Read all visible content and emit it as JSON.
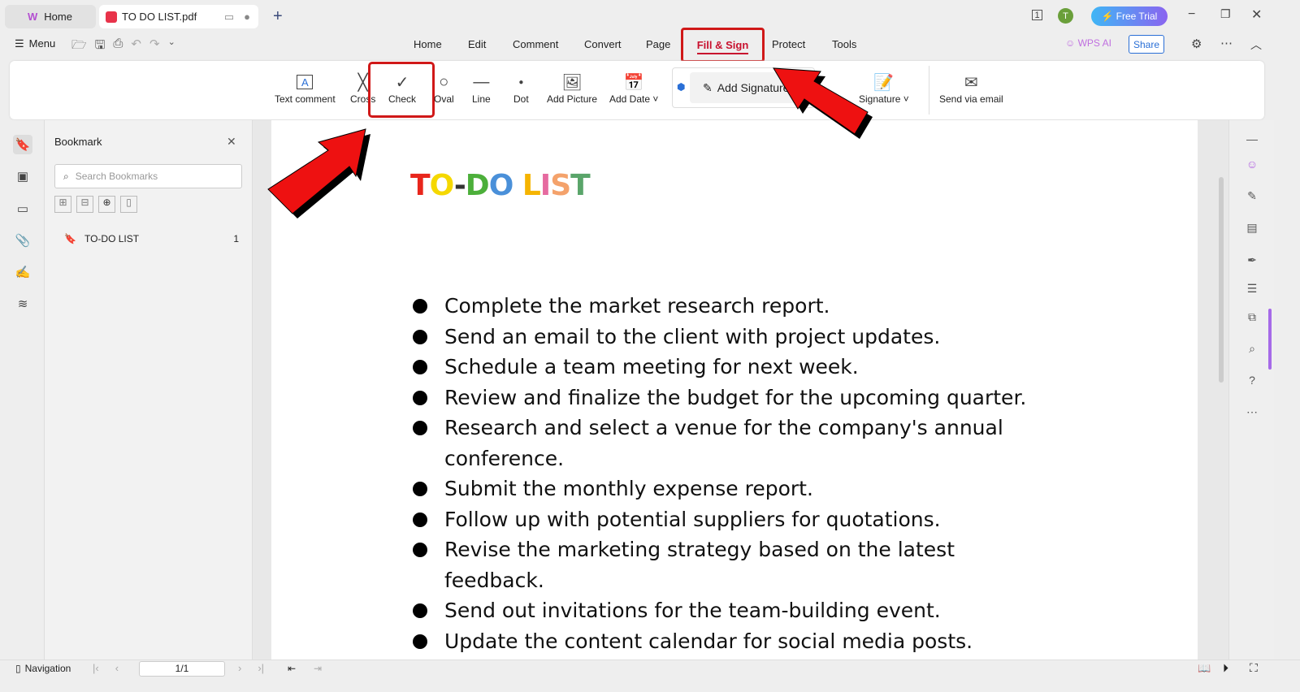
{
  "tabs": {
    "home": "Home",
    "doc": "TO DO LIST.pdf"
  },
  "title_bar": {
    "avatar": "T",
    "free_trial": "Free Trial"
  },
  "toolbar": {
    "menu": "Menu"
  },
  "menu_tabs": [
    "Home",
    "Edit",
    "Comment",
    "Convert",
    "Page",
    "Fill & Sign",
    "Protect",
    "Tools"
  ],
  "active_tab": "Fill & Sign",
  "right_menu": {
    "wps_ai": "WPS AI",
    "share": "Share"
  },
  "ribbon": {
    "text_comment": "Text comment",
    "cross": "Cross",
    "check": "Check",
    "oval": "Oval",
    "line": "Line",
    "dot": "Dot",
    "add_picture": "Add Picture",
    "add_date": "Add Date",
    "add_signature": "Add Signature",
    "signature": "Signature",
    "send_email": "Send via email"
  },
  "bookmark": {
    "title": "Bookmark",
    "search_placeholder": "Search Bookmarks",
    "items": [
      {
        "label": "TO-DO LIST",
        "page": "1"
      }
    ]
  },
  "document": {
    "title_letters": [
      {
        "c": "T",
        "color": "#e8261c"
      },
      {
        "c": "O",
        "color": "#f5d800"
      },
      {
        "c": "-",
        "color": "#333333"
      },
      {
        "c": "D",
        "color": "#4caf3a"
      },
      {
        "c": "O",
        "color": "#4a90d9"
      },
      {
        "c": " ",
        "color": "#000000"
      },
      {
        "c": "L",
        "color": "#f5b400"
      },
      {
        "c": "I",
        "color": "#e66aa0"
      },
      {
        "c": "S",
        "color": "#f4a26b"
      },
      {
        "c": "T",
        "color": "#5aa56a"
      }
    ],
    "items": [
      "Complete the market research report.",
      "Send an email to the client with project updates.",
      "Schedule a team meeting for next week.",
      "Review and finalize the budget for the upcoming quarter.",
      "Research and select a venue for the company's annual conference.",
      "Submit the monthly expense report.",
      "Follow up with potential suppliers for quotations.",
      "Revise the marketing strategy based on the latest feedback.",
      "Send out invitations for the team-building event.",
      "Update the content calendar for social media posts."
    ]
  },
  "status": {
    "navigation": "Navigation",
    "page": "1/1"
  },
  "colors": {
    "accent": "#c8102e",
    "highlight": "#d00000"
  }
}
